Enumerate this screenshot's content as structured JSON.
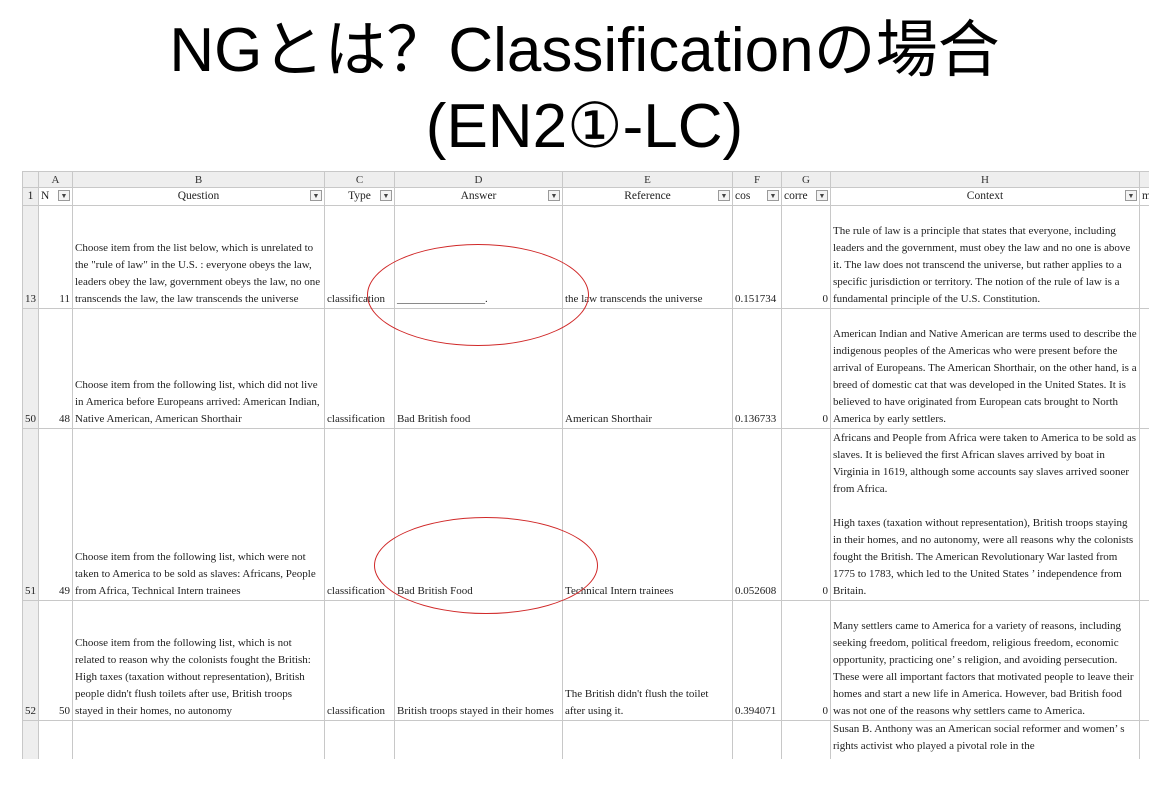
{
  "slide": {
    "title_line1": "NGとは？Classificationの場合",
    "title_line2": "(EN2①-LC)"
  },
  "sheet": {
    "col_letters": [
      "A",
      "B",
      "C",
      "D",
      "E",
      "F",
      "G",
      "H"
    ],
    "header_row_num": "1",
    "headers": [
      "N",
      "Question",
      "Type",
      "Answer",
      "Reference",
      "cos",
      "corre",
      "Context",
      "m"
    ],
    "rows": [
      {
        "rownum": "13",
        "n": "11",
        "question": "Choose item from the list below, which is unrelated to the \"rule of law\" in the U.S. : everyone obeys the law, leaders obey the law, government obeys the law, no one transcends the law, the law transcends the universe",
        "type": "classification",
        "answer": "________________.",
        "reference": "the law transcends the universe",
        "cos": "0.151734",
        "corr": "0",
        "context": "The rule of law is a principle that states that everyone, including leaders and the government, must obey the law and no one is above it. The law does not transcend the universe, but rather applies to a specific jurisdiction or territory. The notion of the rule of law is a fundamental principle of the U.S. Constitution."
      },
      {
        "rownum": "50",
        "n": "48",
        "question": "Choose item from the following list, which did not live in America before Europeans arrived: American Indian, Native American, American Shorthair",
        "type": "classification",
        "answer": "Bad British food",
        "reference": "American Shorthair",
        "cos": "0.136733",
        "corr": "0",
        "context": "American Indian and Native American are terms used to describe the indigenous peoples of the Americas who were present before the arrival of Europeans. The American Shorthair, on the other hand, is a breed of domestic cat that was developed in the United States. It is believed to have originated from European cats brought to North America by early settlers."
      },
      {
        "rownum": "51",
        "n": "49",
        "question": "Choose item from the following list, which were not taken to America to be sold as slaves: Africans, People from Africa, Technical Intern trainees",
        "type": "classification",
        "answer": "Bad British Food",
        "reference": "Technical Intern trainees",
        "cos": "0.052608",
        "corr": "0",
        "context": "Africans and People from Africa were taken to America to be sold as slaves. It is believed the first African slaves arrived by boat in Virginia in 1619, although some accounts say slaves arrived sooner from Africa.",
        "context2": "High taxes (taxation without representation), British troops staying in their homes, and no autonomy, were all reasons why the colonists fought the British. The American Revolutionary War lasted from 1775 to 1783, which led to the United States ’ independence from Britain."
      },
      {
        "rownum": "52",
        "n": "50",
        "question": "Choose item from the following list, which is not related to reason why the colonists fought the British: High taxes (taxation without representation), British people didn't flush toilets after use, British troops stayed in their homes, no autonomy",
        "type": "classification",
        "answer": "British troops stayed in their homes",
        "reference": "The British didn't flush the toilet after using it.",
        "cos": "0.394071",
        "corr": "0",
        "context": "Many settlers came to America for a variety of reasons, including seeking freedom, political freedom, religious freedom, economic opportunity, practicing one’ s religion, and avoiding persecution. These were all important factors that motivated people to leave their homes and start a new life in America. However, bad British food was not one of the reasons why settlers came to America."
      },
      {
        "rownum": "",
        "n": "",
        "question": "",
        "type": "",
        "answer": "",
        "reference": "",
        "cos": "",
        "corr": "",
        "context": "Susan B. Anthony was an American social reformer and women’ s rights activist who played a pivotal role in the"
      }
    ]
  },
  "annotation_color": "#d02828"
}
